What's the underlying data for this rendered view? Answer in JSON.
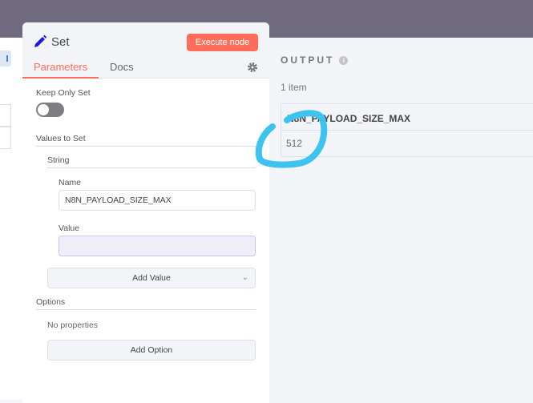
{
  "node": {
    "title": "Set",
    "execute_label": "Execute node",
    "tabs": [
      "Parameters",
      "Docs"
    ],
    "icon": "pencil-icon"
  },
  "params": {
    "keep_only_set_label": "Keep Only Set",
    "keep_only_set": false,
    "values_to_set": "Values to Set",
    "string_label": "String",
    "name_label": "Name",
    "name_value": "N8N_PAYLOAD_SIZE_MAX",
    "value_label": "Value",
    "value_value": "",
    "add_value": "Add Value",
    "options_label": "Options",
    "no_properties": "No properties",
    "add_option": "Add Option"
  },
  "output": {
    "title": "OUTPUT",
    "count": "1 item",
    "columns": [
      "N8N_PAYLOAD_SIZE_MAX"
    ],
    "rows": [
      [
        "512"
      ]
    ]
  },
  "colors": {
    "accent": "#ff6d5a",
    "annotation": "#3cc3ee"
  }
}
